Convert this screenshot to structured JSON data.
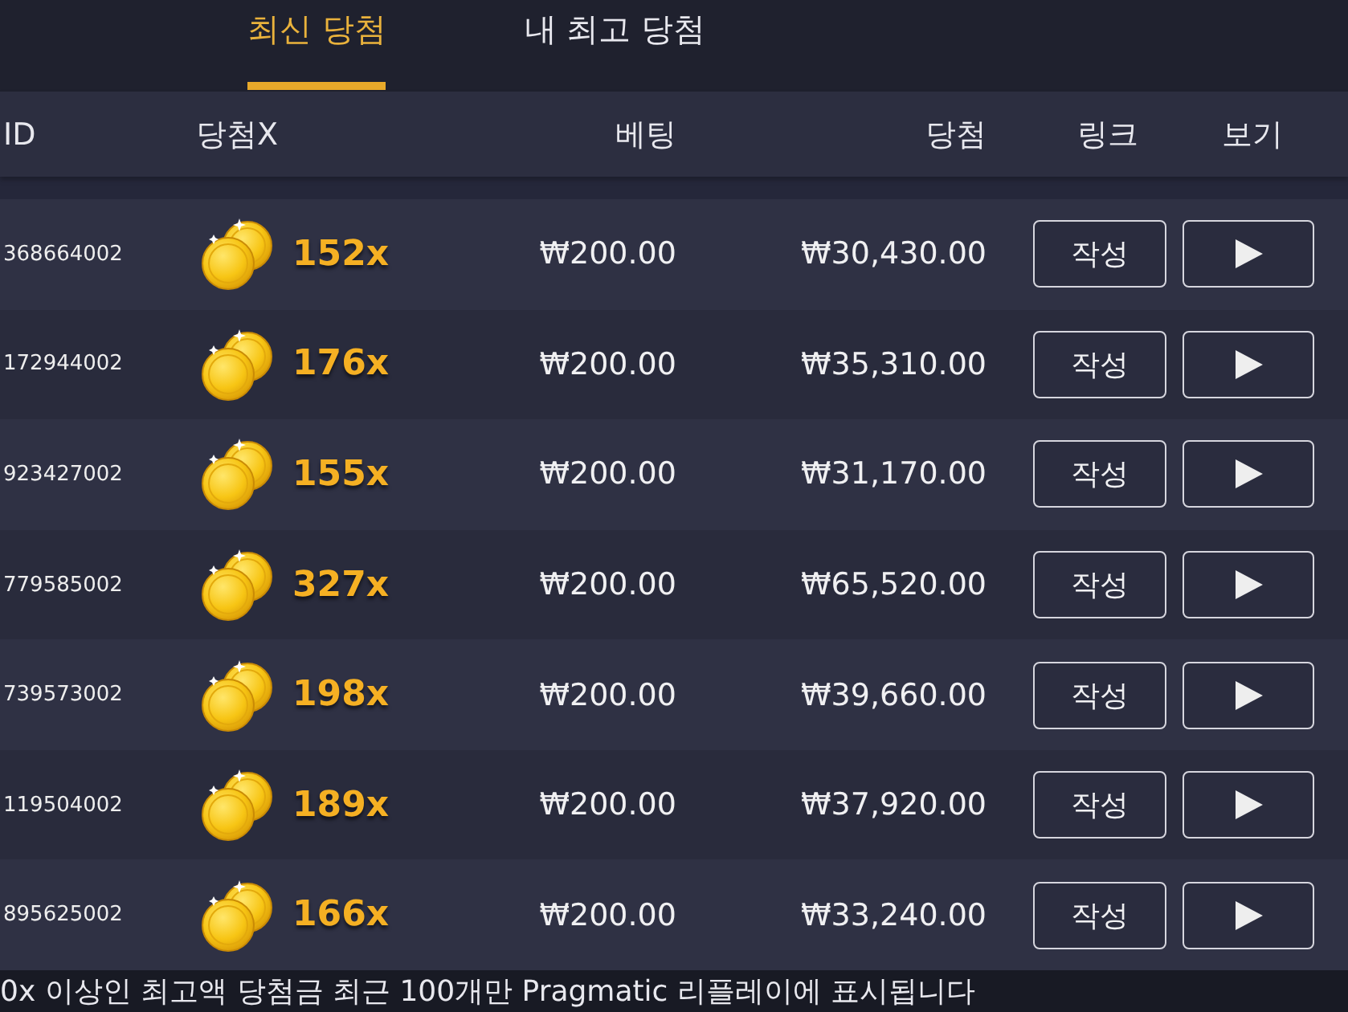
{
  "tabs": [
    {
      "label": "최신 당첨",
      "selected": true
    },
    {
      "label": "내 최고 당첨",
      "selected": false
    }
  ],
  "table": {
    "columns": [
      "ID",
      "당첨X",
      "베팅",
      "당첨",
      "링크",
      "보기"
    ],
    "rows": [
      {
        "id": "368664002",
        "multiplier": "152x",
        "bet": "₩200.00",
        "win": "₩30,430.00",
        "link_button": "작성"
      },
      {
        "id": "172944002",
        "multiplier": "176x",
        "bet": "₩200.00",
        "win": "₩35,310.00",
        "link_button": "작성"
      },
      {
        "id": "923427002",
        "multiplier": "155x",
        "bet": "₩200.00",
        "win": "₩31,170.00",
        "link_button": "작성"
      },
      {
        "id": "779585002",
        "multiplier": "327x",
        "bet": "₩200.00",
        "win": "₩65,520.00",
        "link_button": "작성"
      },
      {
        "id": "739573002",
        "multiplier": "198x",
        "bet": "₩200.00",
        "win": "₩39,660.00",
        "link_button": "작성"
      },
      {
        "id": "119504002",
        "multiplier": "189x",
        "bet": "₩200.00",
        "win": "₩37,920.00",
        "link_button": "작성"
      },
      {
        "id": "895625002",
        "multiplier": "166x",
        "bet": "₩200.00",
        "win": "₩33,240.00",
        "link_button": "작성"
      }
    ]
  },
  "footer_note": "0x 이상인 최고액 당첨금 최근 100개만 Pragmatic 리플레이에 표시됩니다"
}
